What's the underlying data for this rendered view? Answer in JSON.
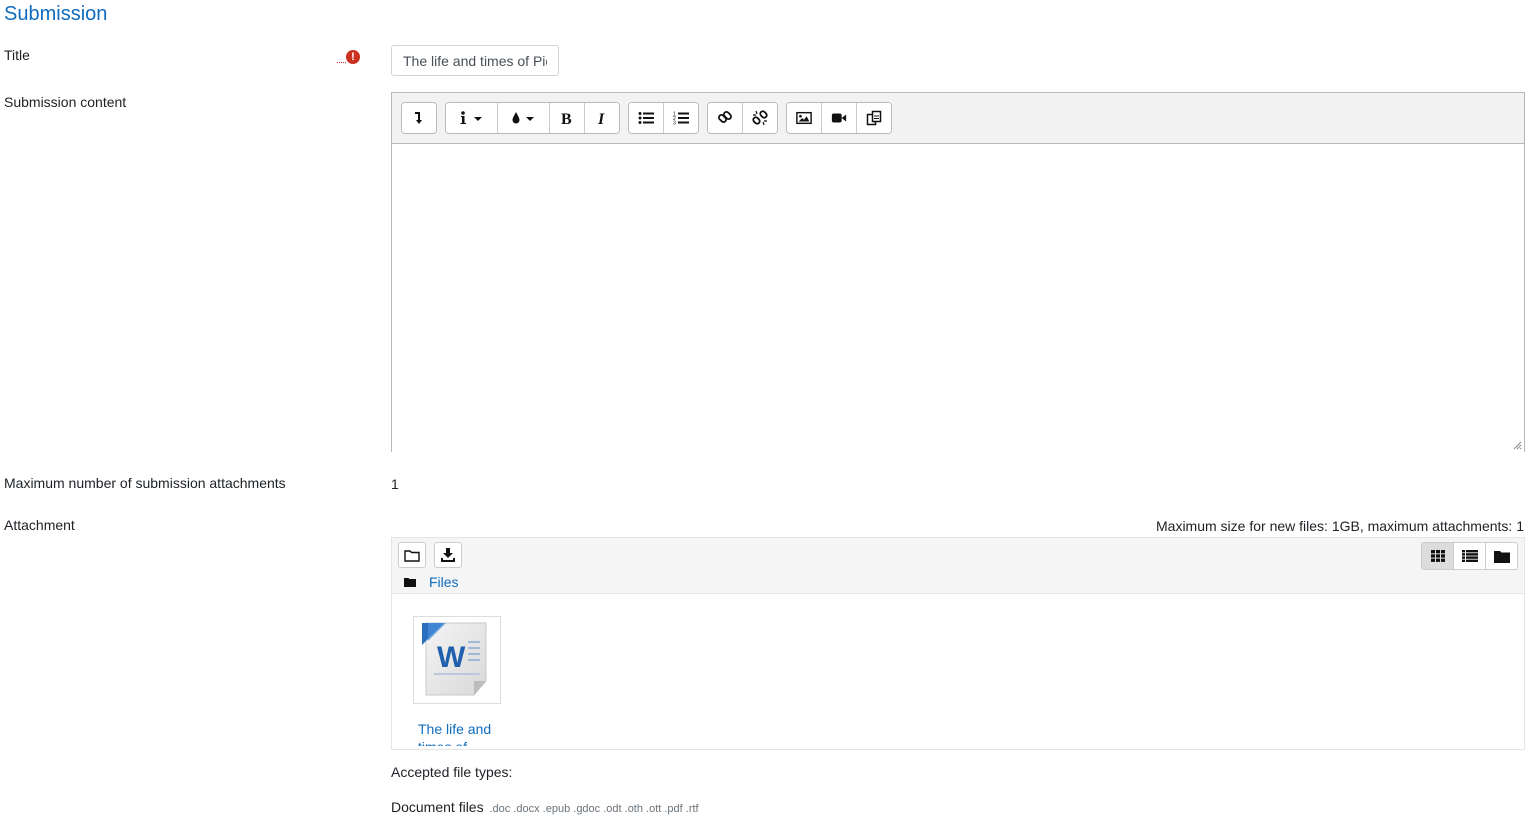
{
  "section_title": "Submission",
  "fields": {
    "title_label": "Title",
    "title_value": "The life and times of Pic",
    "content_label": "Submission content",
    "max_attach_label": "Maximum number of submission attachments",
    "max_attach_value": "1",
    "attachment_label": "Attachment"
  },
  "required_icon": "exclamation-circle-icon",
  "toolbar": {
    "groups": [
      [
        "collapse-icon"
      ],
      [
        "paragraph-style-icon",
        "text-color-icon",
        "bold-icon",
        "italic-icon"
      ],
      [
        "bullet-list-icon",
        "numbered-list-icon"
      ],
      [
        "link-icon",
        "unlink-icon"
      ],
      [
        "image-icon",
        "video-icon",
        "manage-files-icon"
      ]
    ]
  },
  "filepicker": {
    "max_size_text": "Maximum size for new files: 1GB, maximum attachments: 1",
    "path_label": "Files",
    "files": [
      {
        "name": "The life and times of",
        "icon": "word-document-icon"
      }
    ],
    "view_modes": [
      "grid-icon",
      "list-icon",
      "folder-icon"
    ],
    "active_view": "grid-icon"
  },
  "accepted": {
    "heading": "Accepted file types:",
    "group_label": "Document files",
    "extensions": ".doc .docx .epub .gdoc .odt .oth .ott .pdf .rtf"
  },
  "colors": {
    "link": "#0f6cbf",
    "required": "#ca3120",
    "toolbar_bg": "#f2f2f2"
  }
}
